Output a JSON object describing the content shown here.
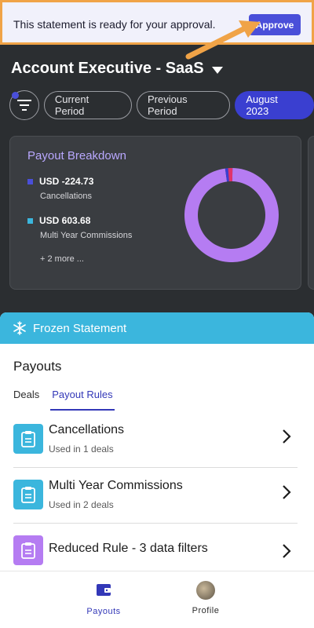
{
  "banner": {
    "message": "This statement is ready for your approval.",
    "approve_label": "Approve",
    "accent": "#f0a347"
  },
  "header": {
    "title": "Account Executive - SaaS"
  },
  "filters": {
    "pills": [
      {
        "label": "Current Period",
        "active": false
      },
      {
        "label": "Previous Period",
        "active": false
      },
      {
        "label": "August 2023",
        "active": true
      }
    ]
  },
  "payout_card": {
    "title": "Payout Breakdown",
    "items": [
      {
        "value": "USD -224.73",
        "label": "Cancellations",
        "color": "#4a4fd9"
      },
      {
        "value": "USD 603.68",
        "label": "Multi Year Commissions",
        "color": "#3bb6dd"
      }
    ],
    "more": "+ 2 more ...",
    "donut": {
      "segments": [
        {
          "name": "Purple",
          "color": "#b57cf2",
          "fraction": 0.975
        },
        {
          "name": "Red",
          "color": "#e0336a",
          "fraction": 0.015
        },
        {
          "name": "Blue",
          "color": "#3a3fd0",
          "fraction": 0.01
        }
      ]
    }
  },
  "sheet": {
    "frozen_label": "Frozen Statement",
    "section_title": "Payouts",
    "tabs": [
      {
        "label": "Deals",
        "active": false
      },
      {
        "label": "Payout Rules",
        "active": true
      }
    ],
    "rules": [
      {
        "name": "Cancellations",
        "usage": "Used in 1 deals",
        "color": "#3bb6dd"
      },
      {
        "name": "Multi Year Commissions",
        "usage": "Used in 2 deals",
        "color": "#3bb6dd"
      },
      {
        "name": "Reduced Rule - 3 data filters",
        "usage": "",
        "color": "#b57cf2"
      }
    ]
  },
  "bottom_nav": {
    "items": [
      {
        "label": "Payouts",
        "active": true
      },
      {
        "label": "Profile",
        "active": false
      }
    ]
  }
}
